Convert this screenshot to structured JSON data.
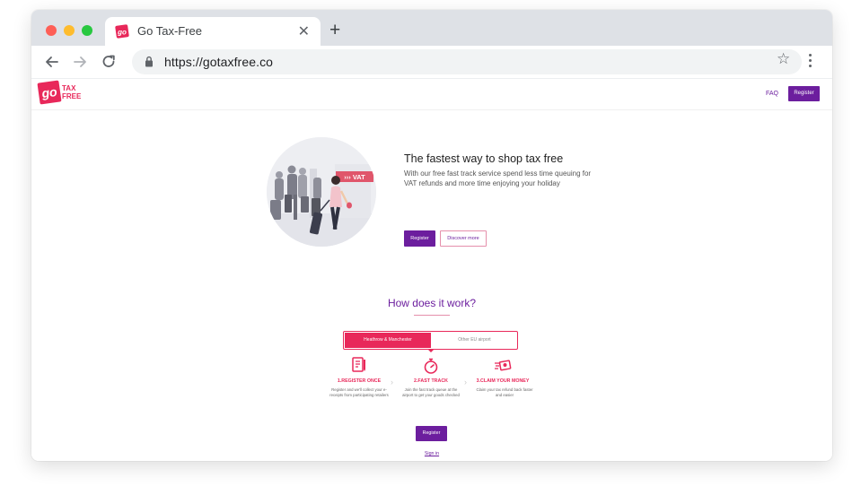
{
  "browser": {
    "tab_title": "Go Tax-Free",
    "url": "https://gotaxfree.co"
  },
  "site": {
    "logo": {
      "go": "go",
      "line1": "TAX",
      "line2": "FREE"
    },
    "nav": {
      "faq": "FAQ",
      "register": "Register"
    }
  },
  "hero": {
    "title": "The fastest way to shop tax free",
    "text": "With our free fast track service spend less time queuing for VAT refunds and more time enjoying your holiday",
    "vat_sign": "››› VAT",
    "register": "Register",
    "discover": "Discover more"
  },
  "how": {
    "title": "How does it work?",
    "toggle": [
      "Heathrow & Manchester",
      "Other EU airport"
    ],
    "steps": [
      {
        "title": "1.REGISTER ONCE",
        "text": "Register and we'll collect your e-receipts from participating retailers",
        "icon": "document-icon"
      },
      {
        "title": "2.FAST TRACK",
        "text": "Join the fast track queue at the airport to get your goods checked",
        "icon": "stopwatch-icon"
      },
      {
        "title": "3.CLAIM YOUR MONEY",
        "text": "Claim your tax refund back faster and easier",
        "icon": "fast-cash-icon"
      }
    ],
    "register": "Register",
    "signin": "Sign in"
  },
  "colors": {
    "brand_pink": "#e8285a",
    "brand_purple": "#6c1e9e"
  }
}
